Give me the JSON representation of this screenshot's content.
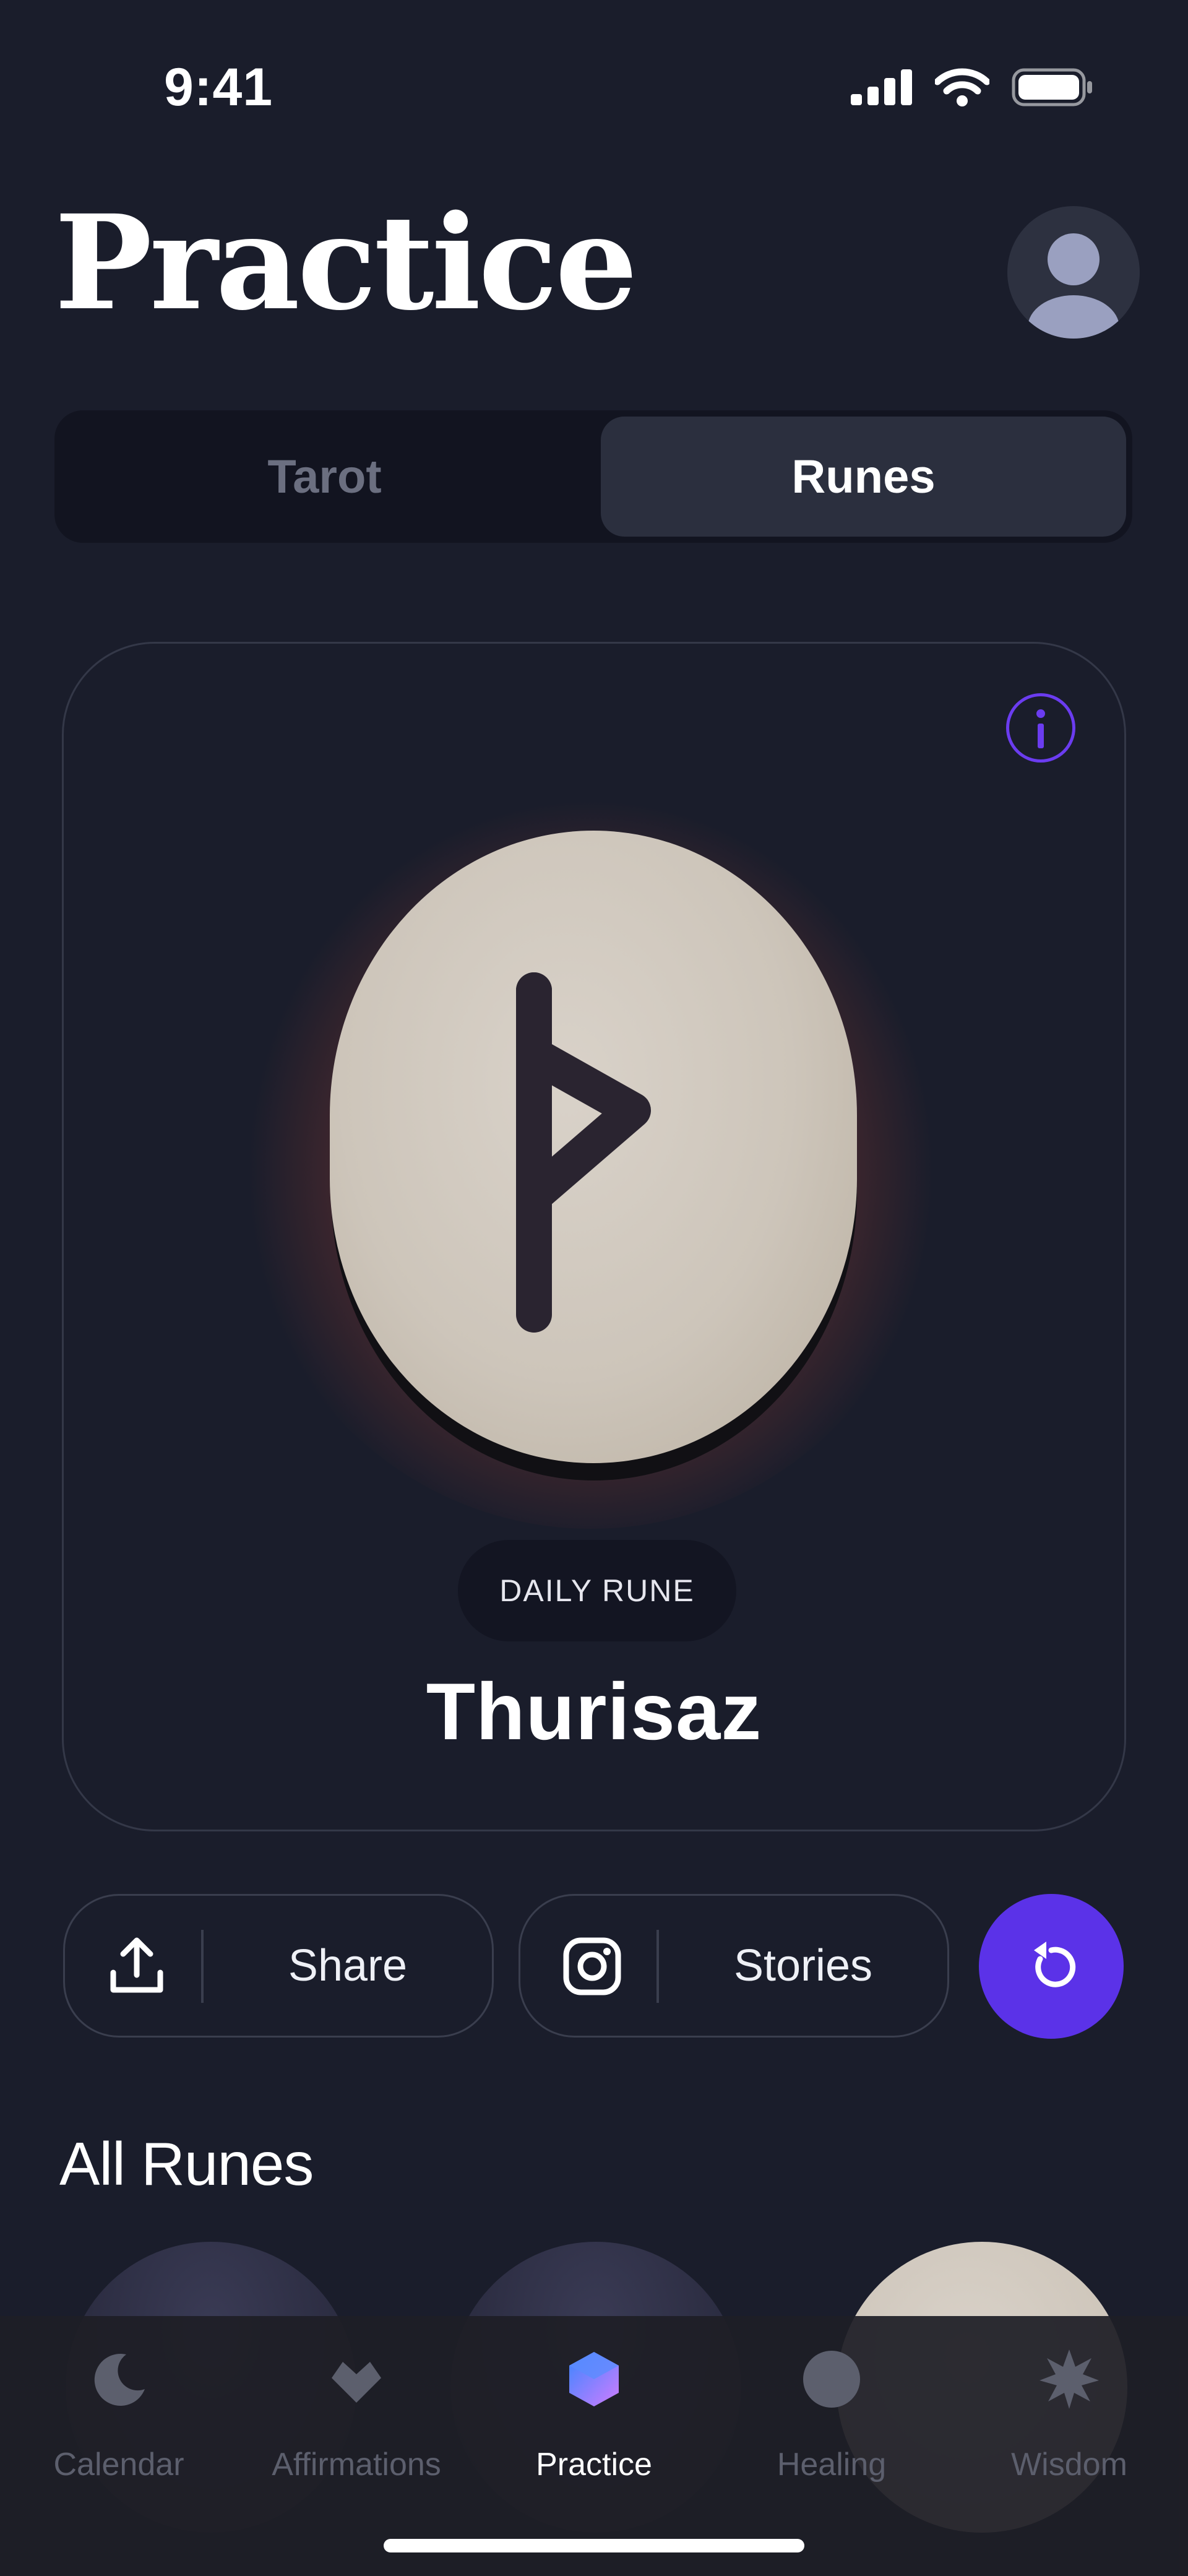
{
  "status_bar": {
    "time": "9:41",
    "icons": [
      "cellular-signal-icon",
      "wifi-icon",
      "battery-icon"
    ]
  },
  "header": {
    "title": "Practice",
    "avatar_icon": "user-avatar-icon"
  },
  "segments": [
    {
      "label": "Tarot",
      "selected": false
    },
    {
      "label": "Runes",
      "selected": true
    }
  ],
  "daily_rune": {
    "info_icon": "info-icon",
    "glyph": "ᚦ",
    "badge": "DAILY RUNE",
    "name": "Thurisaz"
  },
  "actions": {
    "share": {
      "label": "Share",
      "icon": "upload-share-icon"
    },
    "stories": {
      "label": "Stories",
      "icon": "instagram-icon"
    },
    "refresh_icon": "refresh-icon"
  },
  "all_runes": {
    "title": "All Runes"
  },
  "nav": [
    {
      "label": "Calendar",
      "icon": "moon-icon",
      "active": false
    },
    {
      "label": "Affirmations",
      "icon": "heart-icon",
      "active": false
    },
    {
      "label": "Practice",
      "icon": "gem-icon",
      "active": true
    },
    {
      "label": "Healing",
      "icon": "circle-icon",
      "active": false
    },
    {
      "label": "Wisdom",
      "icon": "star-burst-icon",
      "active": false
    }
  ],
  "colors": {
    "background": "#1a1d2b",
    "accent": "#5b32e8",
    "glow": "#e46a45",
    "stone": "#d2cbc1"
  }
}
